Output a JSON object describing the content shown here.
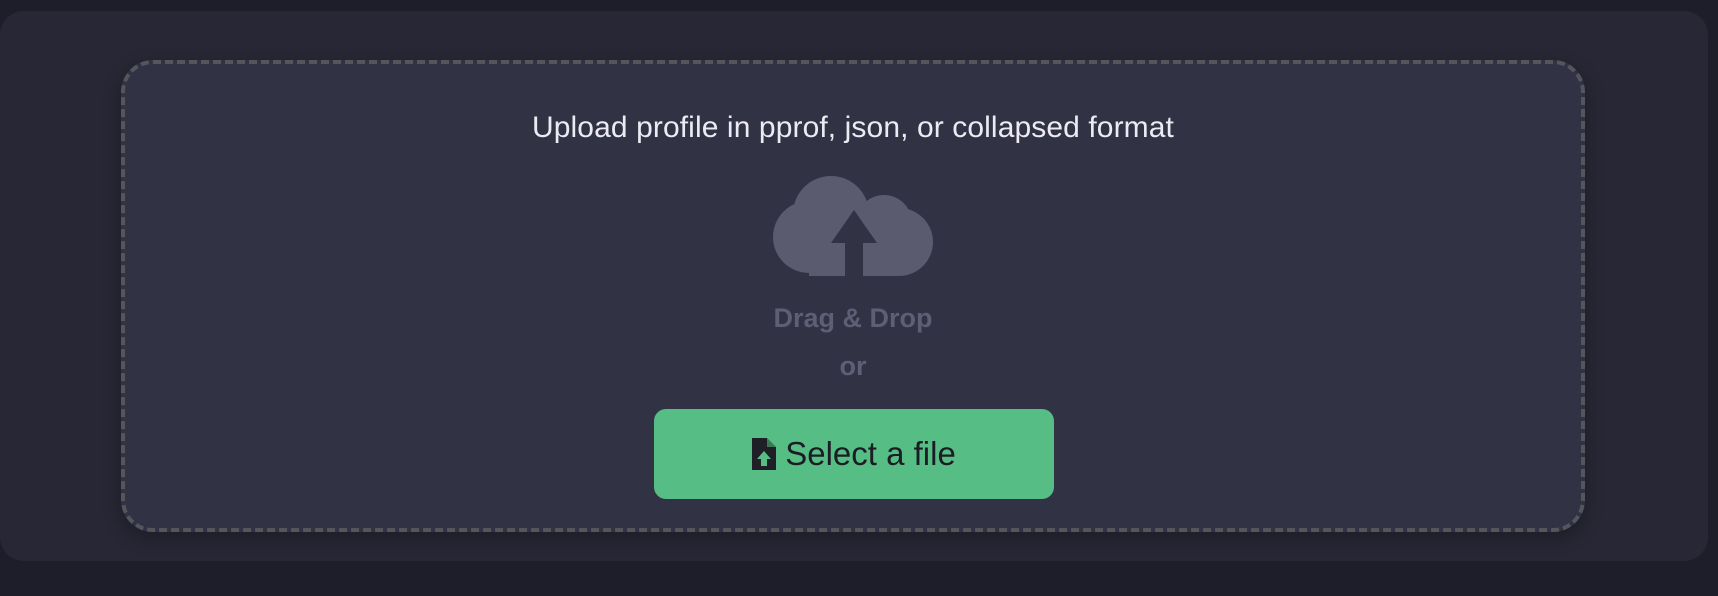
{
  "upload": {
    "title": "Upload profile in pprof, json, or collapsed format",
    "cloud_icon": "cloud-upload-icon",
    "drag_label": "Drag & Drop",
    "or_label": "or",
    "select_button": {
      "label": "Select a file",
      "icon": "file-upload-icon"
    }
  },
  "colors": {
    "page_background": "#1e1e2a",
    "panel_background": "#272735",
    "dropzone_background": "#323245",
    "dropzone_border": "#55555c",
    "accent_button": "#56bd84",
    "muted_text": "#5e5e74",
    "title_text": "#ecebf3"
  }
}
